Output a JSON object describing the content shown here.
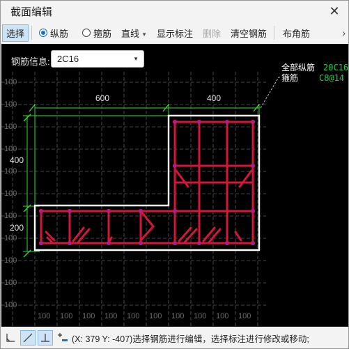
{
  "window": {
    "title": "截面编辑",
    "close_icon": "close-icon"
  },
  "toolbar": {
    "select": "选择",
    "longitudinal": "纵筋",
    "stirrup": "箍筋",
    "line": "直线",
    "show_dims": "显示标注",
    "delete": "删除",
    "clear_rebar": "清空钢筋",
    "corner_rebar": "布角筋",
    "more_icon": "chevron-right-icon"
  },
  "rebar_info": {
    "label": "钢筋信息:",
    "value": "2C16"
  },
  "legend": {
    "all_long_label": "全部纵筋",
    "all_long_value": "20C16",
    "stirrup_label": "箍筋",
    "stirrup_value": "C8@14"
  },
  "dimensions": {
    "top_left": "600",
    "top_right": "400",
    "left_upper": "400",
    "left_lower": "200"
  },
  "grid": {
    "label": "100"
  },
  "colors": {
    "rebar": "#d4163a",
    "dimension": "#33dd33",
    "outline": "#ffffff",
    "grid": "#5a5a5a",
    "accent": "#1a73c9"
  },
  "statusbar": {
    "tools": [
      "angle-snap-icon",
      "diagonal-line-icon",
      "perpendicular-icon",
      "add-remove-icon"
    ],
    "text": "(X: 379 Y: -407)选择钢筋进行编辑，选择标注进行修改或移动;"
  }
}
